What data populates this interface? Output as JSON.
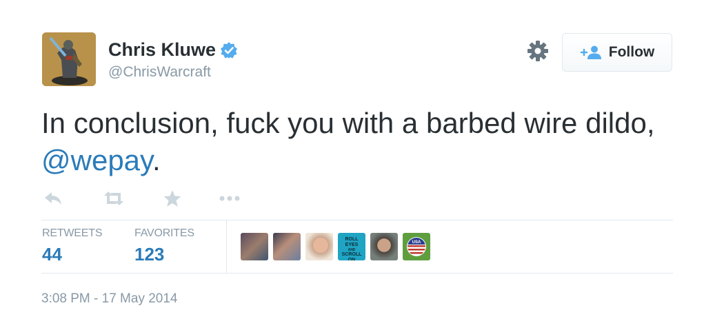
{
  "user": {
    "display_name": "Chris Kluwe",
    "handle": "@ChrisWarcraft",
    "verified": true,
    "avatar_icon": "warcraft-figurine-avatar"
  },
  "header": {
    "settings_icon": "gear-icon",
    "follow_label": "Follow",
    "follow_icon": "add-user-icon"
  },
  "tweet": {
    "text_before": "In conclusion, fuck you with a barbed wire dildo, ",
    "mention": "@wepay",
    "text_after": "."
  },
  "actions": [
    {
      "name": "reply",
      "icon": "reply-icon"
    },
    {
      "name": "retweet",
      "icon": "retweet-icon"
    },
    {
      "name": "favorite",
      "icon": "star-icon"
    },
    {
      "name": "more",
      "icon": "more-icon"
    }
  ],
  "stats": {
    "retweets_label": "RETWEETS",
    "retweets_count": "44",
    "favorites_label": "FAVORITES",
    "favorites_count": "123"
  },
  "favoriters": {
    "badge_lines": [
      "ROLL",
      "EYES",
      "AND",
      "SCROLL",
      "ON"
    ],
    "flag_text": "USA"
  },
  "timestamp": "3:08 PM - 17 May 2014",
  "colors": {
    "link": "#2b7bb9",
    "muted": "#8899a6",
    "verified": "#55acee",
    "text": "#292f33"
  }
}
